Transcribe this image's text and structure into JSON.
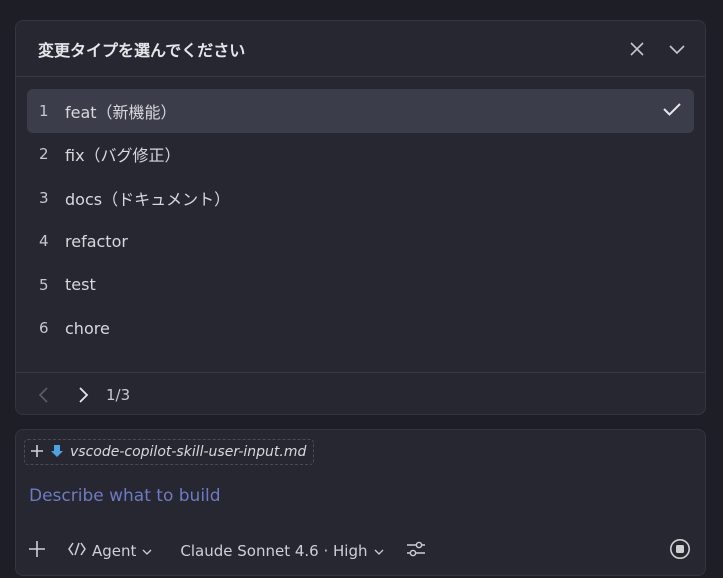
{
  "quickpick": {
    "title": "変更タイプを選んでください",
    "items": [
      {
        "num": "1",
        "label": "feat（新機能）",
        "selected": true
      },
      {
        "num": "2",
        "label": "fix（バグ修正）"
      },
      {
        "num": "3",
        "label": "docs（ドキュメント）"
      },
      {
        "num": "4",
        "label": "refactor"
      },
      {
        "num": "5",
        "label": "test"
      },
      {
        "num": "6",
        "label": "chore"
      }
    ],
    "pager": "1/3"
  },
  "chat": {
    "attachment": "vscode-copilot-skill-user-input.md",
    "placeholder": "Describe what to build",
    "mode_label": "Agent",
    "model_label": "Claude Sonnet 4.6 · High"
  },
  "icons": {
    "close": "close-icon",
    "collapse": "chevron-down-icon",
    "check": "check-icon",
    "prev": "chevron-left-icon",
    "next": "chevron-right-icon",
    "add": "plus-icon",
    "file": "markdown-file-icon",
    "agent": "agent-icon",
    "settings": "sliders-icon",
    "stop": "stop-icon"
  },
  "colors": {
    "background": "#1d1e26",
    "panel": "#262731",
    "selected_row": "#3b3d4a",
    "placeholder": "#6f7ac2",
    "file_icon": "#4fa3e0"
  }
}
